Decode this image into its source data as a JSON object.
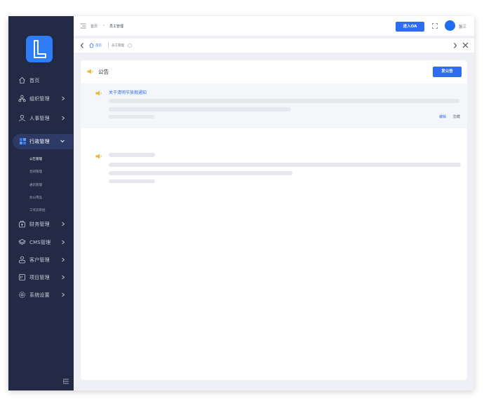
{
  "sidebar": {
    "logo_letter": "L",
    "items": [
      {
        "label": "首页",
        "icon": "home-icon",
        "has_children": false
      },
      {
        "label": "组织管理",
        "icon": "org-icon",
        "has_children": true
      },
      {
        "label": "人事管理",
        "icon": "user-icon",
        "has_children": true
      },
      {
        "label": "行政管理",
        "icon": "admin-icon",
        "has_children": true,
        "expanded": true
      },
      {
        "label": "财务管理",
        "icon": "finance-icon",
        "has_children": true
      },
      {
        "label": "CMS管理",
        "icon": "layers-icon",
        "has_children": true
      },
      {
        "label": "客户管理",
        "icon": "customer-icon",
        "has_children": true
      },
      {
        "label": "项目管理",
        "icon": "project-icon",
        "has_children": true
      },
      {
        "label": "系统设置",
        "icon": "settings-icon",
        "has_children": true
      }
    ],
    "sub_items": [
      "公告管理",
      "合同管理",
      "通讯管理",
      "办公用品",
      "工作流审批"
    ],
    "active_sub_index": 0
  },
  "topbar": {
    "breadcrumb": [
      "首页",
      "员工管理"
    ],
    "oa_button": "进入OA",
    "username": "张三"
  },
  "tabs": {
    "home": "首页",
    "current": "员工管理"
  },
  "announcements": {
    "title": "公告",
    "publish_button": "发公告",
    "items": [
      {
        "title": "关于清明节放假通知",
        "actions": [
          "编辑",
          "隐藏"
        ]
      }
    ]
  },
  "colors": {
    "sidebar_bg": "#232a45",
    "accent": "#2d6cf3",
    "speaker": "#f5b334"
  }
}
